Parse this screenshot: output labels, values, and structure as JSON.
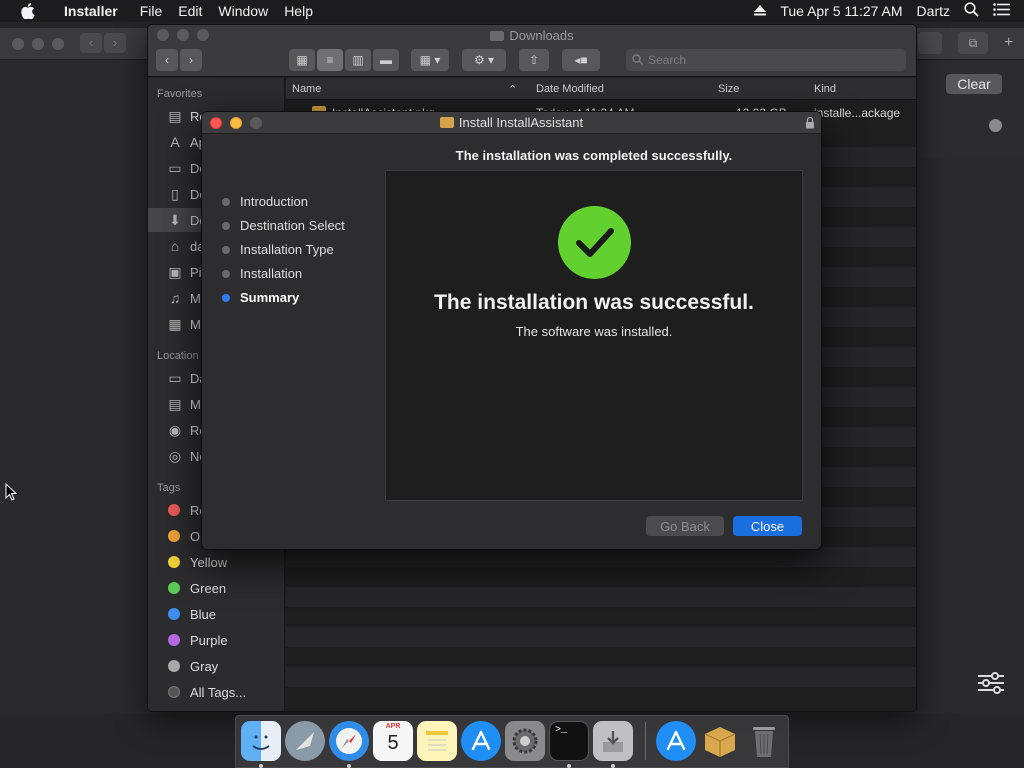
{
  "menubar": {
    "app_name": "Installer",
    "items": [
      "File",
      "Edit",
      "Window",
      "Help"
    ],
    "datetime": "Tue Apr 5  11:27 AM",
    "user": "Dartz"
  },
  "finder": {
    "title": "Downloads",
    "search_placeholder": "Search",
    "sidebar": {
      "favorites_header": "Favorites",
      "favorites": [
        {
          "label": "Re",
          "icon": "recents-icon"
        },
        {
          "label": "Ap",
          "icon": "applications-icon"
        },
        {
          "label": "De",
          "icon": "desktop-icon"
        },
        {
          "label": "Do",
          "icon": "documents-icon"
        },
        {
          "label": "Do",
          "icon": "downloads-icon"
        },
        {
          "label": "da",
          "icon": "home-icon"
        },
        {
          "label": "Pi",
          "icon": "pictures-icon"
        },
        {
          "label": "M",
          "icon": "music-icon"
        },
        {
          "label": "M",
          "icon": "movies-icon"
        }
      ],
      "locations_header": "Location",
      "locations": [
        {
          "label": "Da",
          "icon": "computer-icon"
        },
        {
          "label": "M",
          "icon": "disk-icon"
        },
        {
          "label": "Re",
          "icon": "cd-icon"
        },
        {
          "label": "Ne",
          "icon": "network-icon"
        }
      ],
      "tags_header": "Tags",
      "tags": [
        {
          "label": "Re",
          "color": "#ee5a5a"
        },
        {
          "label": "Or",
          "color": "#f0a23a"
        },
        {
          "label": "Yellow",
          "color": "#f2d23c"
        },
        {
          "label": "Green",
          "color": "#5bcc55"
        },
        {
          "label": "Blue",
          "color": "#3e8ef0"
        },
        {
          "label": "Purple",
          "color": "#b765e0"
        },
        {
          "label": "Gray",
          "color": "#a8a8a8"
        },
        {
          "label": "All Tags...",
          "color": "#555555"
        }
      ]
    },
    "columns": {
      "name": "Name",
      "date_modified": "Date Modified",
      "size": "Size",
      "kind": "Kind"
    },
    "rows": [
      {
        "name": "InstallAssistant.pkg",
        "date": "Today at 11:24 AM",
        "size": "12.03 GB",
        "kind": "installe...ackage"
      }
    ]
  },
  "installer": {
    "title": "Install InstallAssistant",
    "heading": "The installation was completed successfully.",
    "steps": [
      {
        "label": "Introduction",
        "active": false
      },
      {
        "label": "Destination Select",
        "active": false
      },
      {
        "label": "Installation Type",
        "active": false
      },
      {
        "label": "Installation",
        "active": false
      },
      {
        "label": "Summary",
        "active": true
      }
    ],
    "success_title": "The installation was successful.",
    "success_subtitle": "The software was installed.",
    "go_back_label": "Go Back",
    "close_label": "Close"
  },
  "notification_panel": {
    "clear_label": "Clear"
  },
  "dock": {
    "items": [
      {
        "name": "finder-icon",
        "running": true
      },
      {
        "name": "launchpad-icon",
        "running": false
      },
      {
        "name": "safari-icon",
        "running": true
      },
      {
        "name": "calendar-icon",
        "running": false,
        "month": "APR",
        "day": "5"
      },
      {
        "name": "notes-icon",
        "running": false
      },
      {
        "name": "app-store-icon",
        "running": false
      },
      {
        "name": "system-preferences-icon",
        "running": false
      },
      {
        "name": "terminal-icon",
        "running": true
      },
      {
        "name": "installer-icon",
        "running": true
      },
      {
        "name": "app-store-download-icon",
        "running": false
      },
      {
        "name": "package-icon",
        "running": false
      },
      {
        "name": "trash-icon",
        "running": false
      }
    ]
  },
  "colors": {
    "accent_blue": "#1a6ee0",
    "success_green": "#62d12f",
    "close_red": "#fc5753",
    "minimize_yellow": "#fdbc40"
  }
}
